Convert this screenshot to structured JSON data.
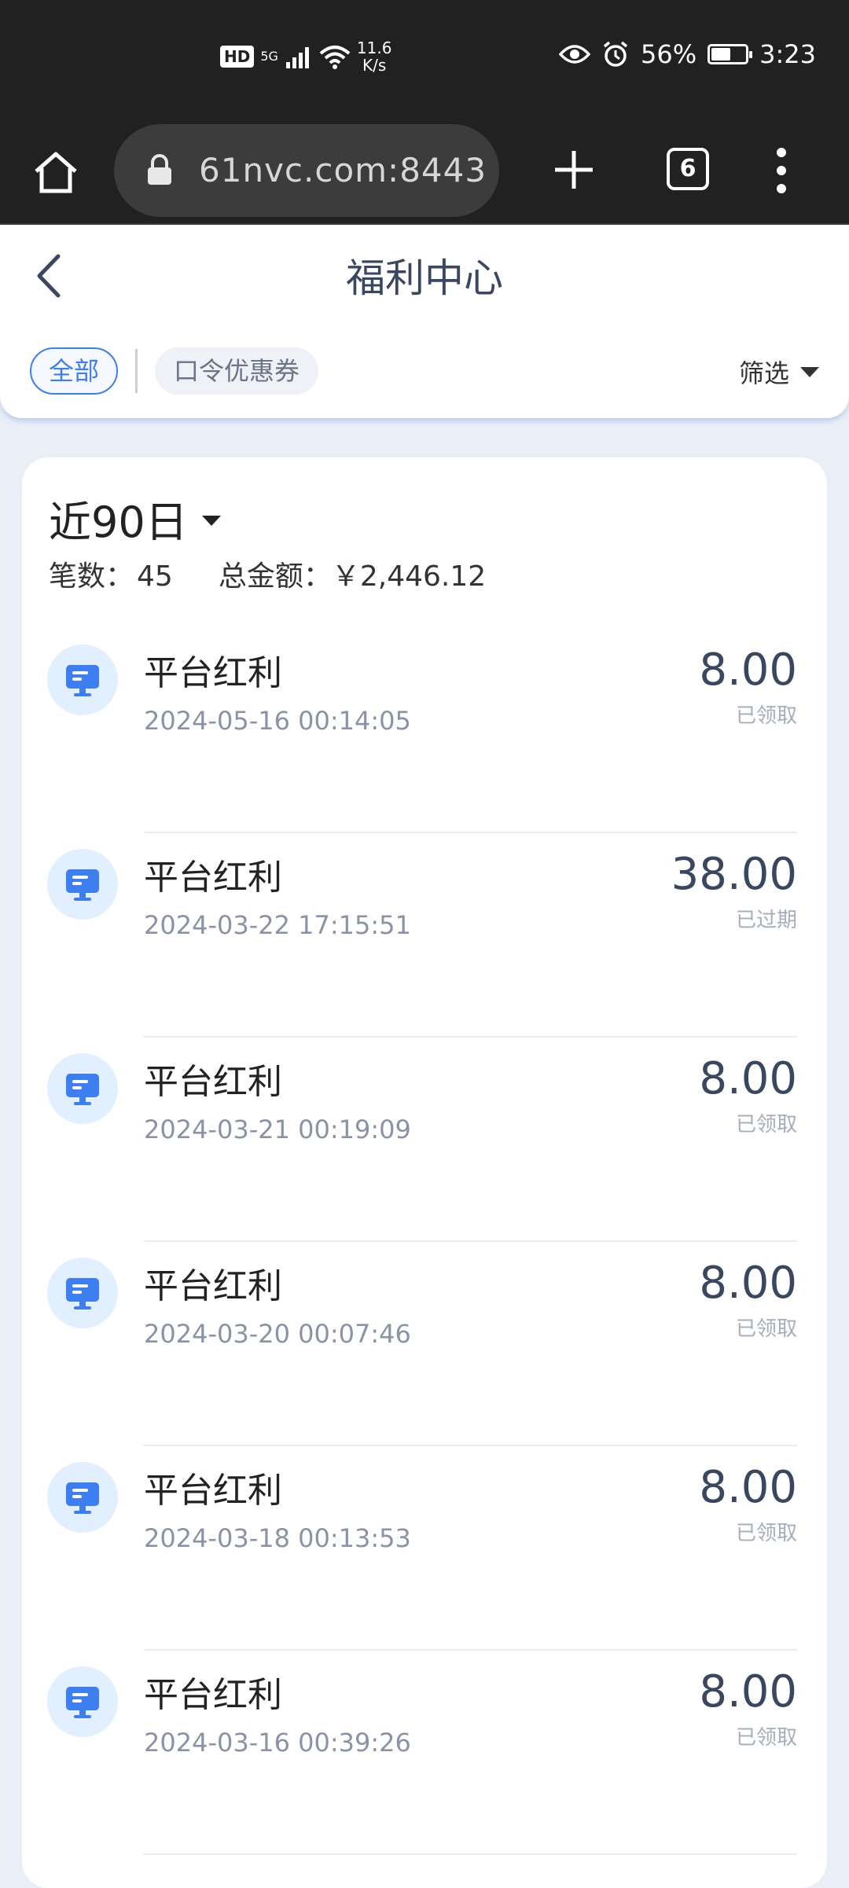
{
  "status_bar": {
    "hd": "HD",
    "net": "5G",
    "speed_value": "11.6",
    "speed_unit": "K/s",
    "battery": "56%",
    "time": "3:23"
  },
  "browser": {
    "url": "61nvc.com:8443",
    "tab_count": "6"
  },
  "header": {
    "title": "福利中心",
    "tabs": [
      {
        "label": "全部",
        "active": true
      },
      {
        "label": "口令优惠券",
        "active": false
      }
    ],
    "filter_label": "筛选"
  },
  "summary": {
    "period": "近90日",
    "count_label": "笔数：",
    "count": "45",
    "total_label": "总金额：",
    "total": "￥2,446.12"
  },
  "records": [
    {
      "name": "平台红利",
      "time": "2024-05-16 00:14:05",
      "amount": "8.00",
      "status": "已领取"
    },
    {
      "name": "平台红利",
      "time": "2024-03-22 17:15:51",
      "amount": "38.00",
      "status": "已过期"
    },
    {
      "name": "平台红利",
      "time": "2024-03-21 00:19:09",
      "amount": "8.00",
      "status": "已领取"
    },
    {
      "name": "平台红利",
      "time": "2024-03-20 00:07:46",
      "amount": "8.00",
      "status": "已领取"
    },
    {
      "name": "平台红利",
      "time": "2024-03-18 00:13:53",
      "amount": "8.00",
      "status": "已领取"
    },
    {
      "name": "平台红利",
      "time": "2024-03-16 00:39:26",
      "amount": "8.00",
      "status": "已领取"
    }
  ],
  "colors": {
    "accent": "#3d7ef0",
    "icon_bg": "#e2efff",
    "page_bg": "#e9eef7"
  }
}
